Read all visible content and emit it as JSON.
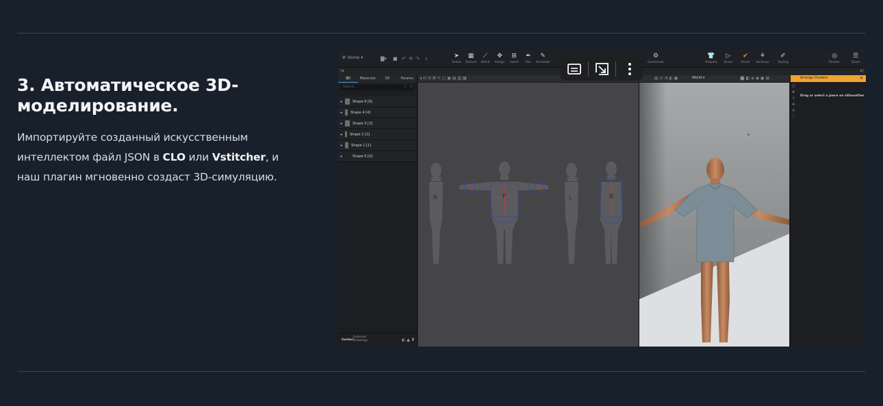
{
  "section": {
    "heading_line1": "3. Автоматическое 3D-",
    "heading_line2": "моделирование.",
    "desc_p1": "Импортируйте созданный искусственным",
    "desc_p2_pre": "интеллектом файл JSON в ",
    "desc_p2_clo": "CLO",
    "desc_p2_mid": " или ",
    "desc_p2_vst": "Vstitcher",
    "desc_p2_post": ", и",
    "desc_p3": "наш плагин мгновенно создаст 3D-симуляцию."
  },
  "app": {
    "home_label": "Home",
    "toolbar": [
      {
        "label": "Select",
        "icon": "cursor-icon"
      },
      {
        "label": "Texture",
        "icon": "texture-icon"
      },
      {
        "label": "Stitch",
        "icon": "needle-icon"
      },
      {
        "label": "Assign",
        "icon": "assign-icon"
      },
      {
        "label": "Insert",
        "icon": "insert-icon"
      },
      {
        "label": "Pen",
        "icon": "pen-icon"
      },
      {
        "label": "Annotate",
        "icon": "annotate-icon"
      }
    ],
    "toolbar_right": [
      {
        "label": "Grommets",
        "icon": "grommet-icon"
      },
      {
        "label": "Prepare",
        "icon": "shirt-icon"
      },
      {
        "label": "Dress",
        "icon": "dress-icon"
      },
      {
        "label": "Finish",
        "icon": "check-icon"
      },
      {
        "label": "Vartman",
        "icon": "vartman-icon"
      },
      {
        "label": "Styling",
        "icon": "styling-icon"
      },
      {
        "label": "Render",
        "icon": "render-icon"
      },
      {
        "label": "Share",
        "icon": "share-icon"
      }
    ],
    "left_tabs": [
      "3D",
      "Materials",
      "3D",
      "Params"
    ],
    "search_placeholder": "Search...",
    "shapes": [
      "Shape 6 [6]",
      "Shape 4 [4]",
      "Shape 3 [3]",
      "Shape 2 [2]",
      "Shape 1 [1]",
      "Shape 0 [0]"
    ],
    "footer_badge": "Gerber",
    "footer_text1": "External",
    "footer_text2": "Drawings",
    "view_dropdown": "World",
    "silhouette_labels": [
      "R",
      "F",
      "L",
      "B"
    ],
    "right_panel_title": "Arrange Clusters",
    "right_panel_hint": "Drag or select a piece on silhouettes"
  },
  "overlay": {
    "subtitles_icon": "subtitles-icon",
    "expand_icon": "expand-icon",
    "more_icon": "more-vertical-icon"
  },
  "colors": {
    "background": "#17202b",
    "accent": "#f0a330",
    "link_blue": "#4aa3df"
  }
}
